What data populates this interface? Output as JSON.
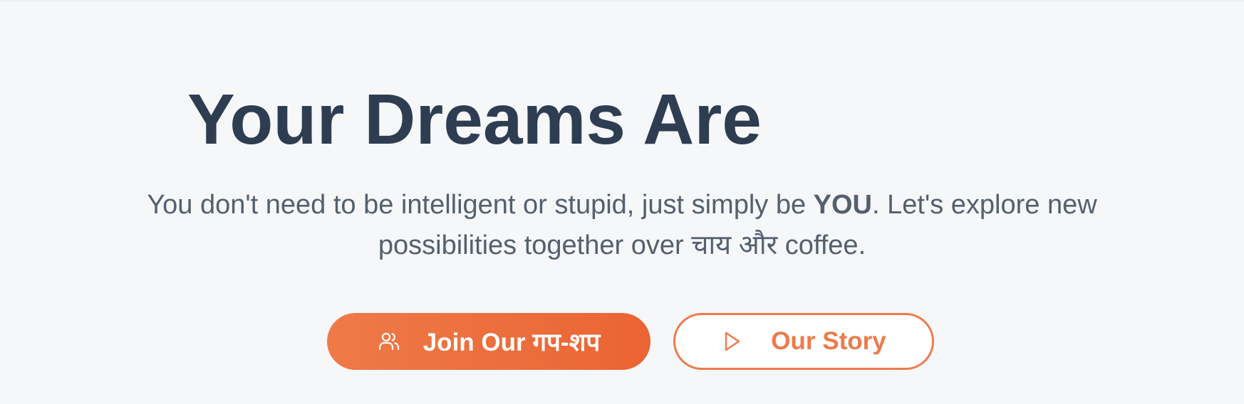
{
  "hero": {
    "headline": "Your Dreams Are",
    "subtitle_before": "You don't need to be intelligent or stupid, just simply be ",
    "subtitle_emphasis": "YOU",
    "subtitle_after": ". Let's explore new possibilities together over चाय और coffee."
  },
  "buttons": {
    "primary_label": "Join Our गप-शप",
    "primary_icon": "users-icon",
    "secondary_label": "Our Story",
    "secondary_icon": "play-icon"
  },
  "colors": {
    "background": "#f5f7f9",
    "headline": "#2e3d51",
    "subtitle": "#555f6e",
    "accent": "#ee7a48"
  }
}
